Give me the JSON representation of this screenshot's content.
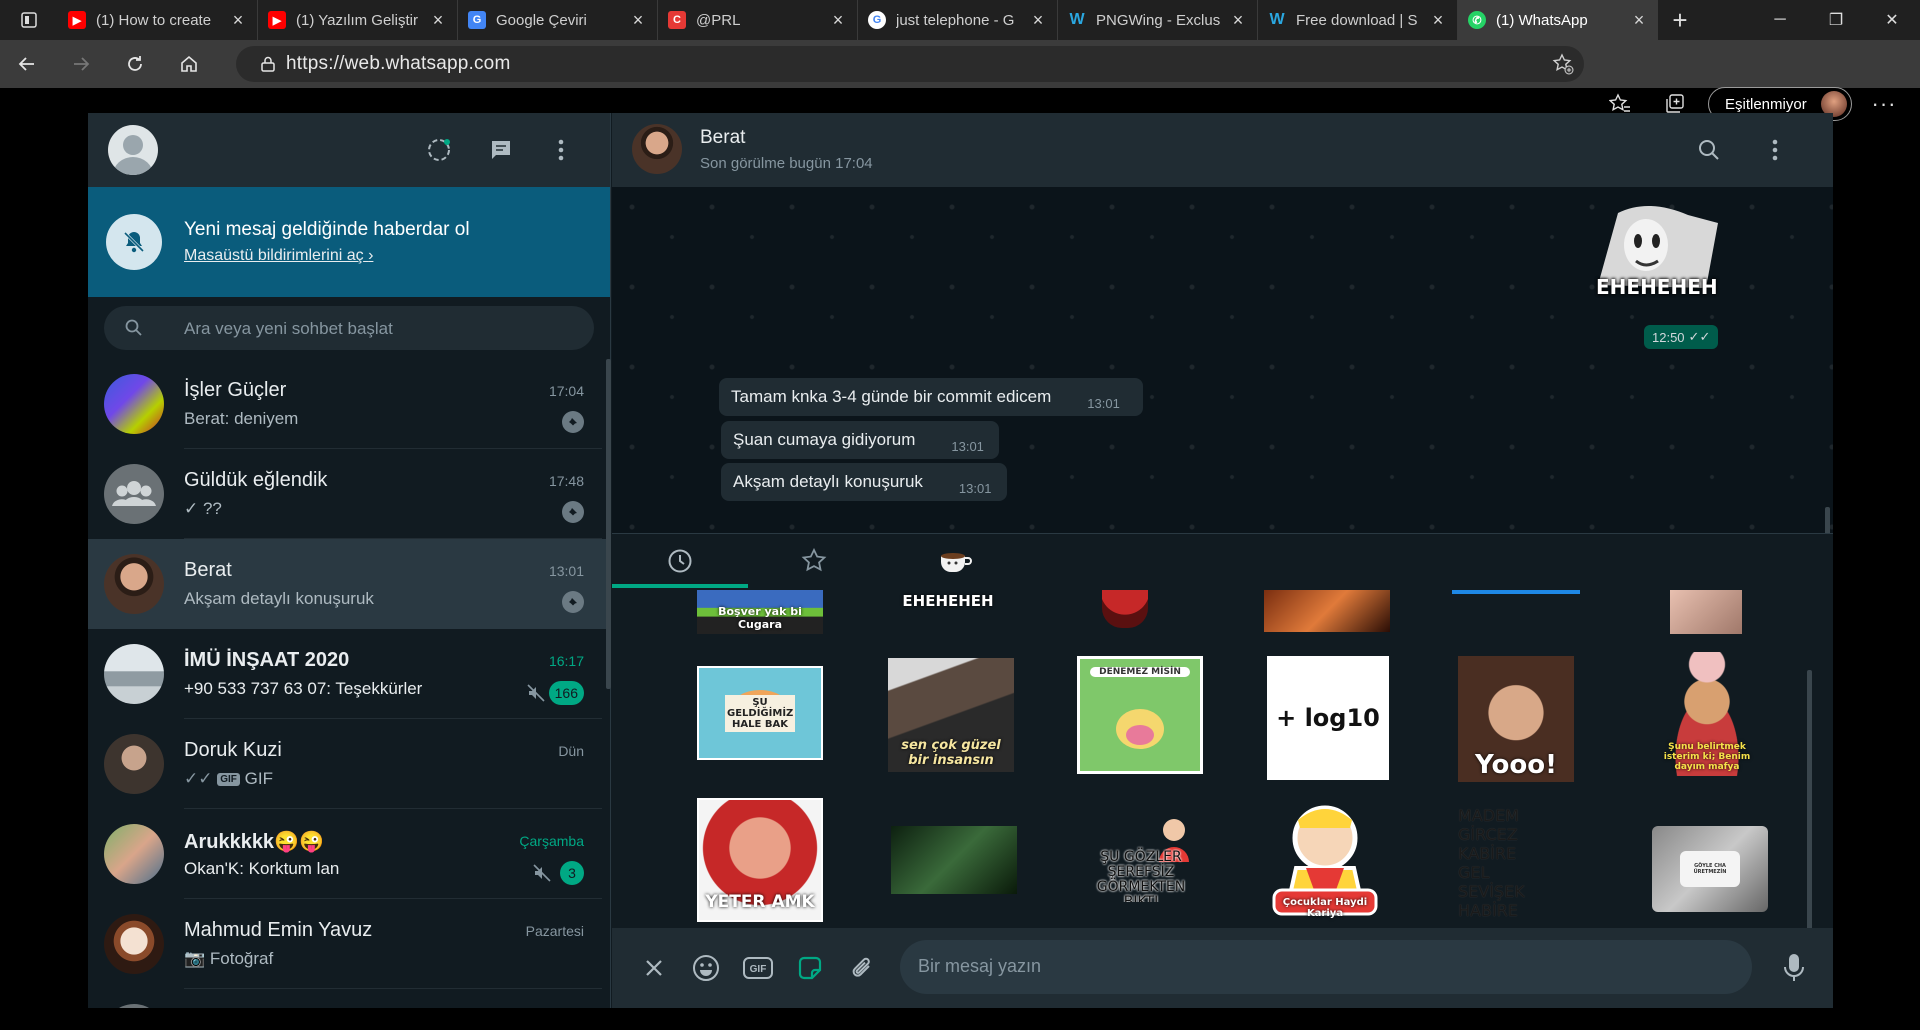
{
  "browser": {
    "tabs": [
      {
        "title": "(1) How to create",
        "icon": "youtube-icon"
      },
      {
        "title": "(1) Yazılım Geliştir",
        "icon": "youtube-icon"
      },
      {
        "title": "Google Çeviri",
        "icon": "google-translate-icon"
      },
      {
        "title": "@PRL",
        "icon": "chrome-web-icon"
      },
      {
        "title": "just telephone - G",
        "icon": "google-icon"
      },
      {
        "title": "PNGWing - Exclus",
        "icon": "pngwing-icon"
      },
      {
        "title": "Free download | S",
        "icon": "pngwing-icon"
      },
      {
        "title": "(1) WhatsApp",
        "icon": "whatsapp-icon"
      }
    ],
    "url": "https://web.whatsapp.com",
    "profile_label": "Eşitlenmiyor"
  },
  "sidebar": {
    "notification": {
      "title": "Yeni mesaj geldiğinde haberdar ol",
      "link": "Masaüstü bildirimlerini aç"
    },
    "search_placeholder": "Ara veya yeni sohbet başlat",
    "chats": [
      {
        "name": "İşler Güçler",
        "preview": "Berat: deniyem",
        "time": "17:04",
        "pinned": true
      },
      {
        "name": "Güldük eğlendik",
        "preview": "✓ ??",
        "time": "17:48",
        "pinned": true
      },
      {
        "name": "Berat",
        "preview": "Akşam detaylı konuşuruk",
        "time": "13:01",
        "pinned": true
      },
      {
        "name": "İMÜ İNŞAAT 2020",
        "preview": "+90 533 737 63 07: Teşekkürler",
        "time": "16:17",
        "unread": "166",
        "muted": true
      },
      {
        "name": "Doruk Kuzi",
        "preview_badge": "GIF",
        "preview": "GIF",
        "time": "Dün"
      },
      {
        "name": "Arukkkkk😜😜",
        "preview": "Okan'K: Korktum lan",
        "time": "Çarşamba",
        "unread": "3",
        "muted": true
      },
      {
        "name": "Mahmud Emin Yavuz",
        "preview": "Fotoğraf",
        "time": "Pazartesi"
      }
    ]
  },
  "conversation": {
    "contact_name": "Berat",
    "contact_status": "Son görülme bugün 17:04",
    "outgoing_sticker_caption": "EHEHEHEH",
    "outgoing_time": "12:50",
    "messages": [
      {
        "text": "Tamam knka 3-4 günde bir commit edicem",
        "time": "13:01"
      },
      {
        "text": "Şuan cumaya gidiyorum",
        "time": "13:01"
      },
      {
        "text": "Akşam detaylı konuşuruk",
        "time": "13:01"
      }
    ]
  },
  "sticker_panel": {
    "row1_captions": [
      "Boşver yak bi Cugara",
      "EHEHEHEH"
    ],
    "row2_captions": [
      "ŞU GELDİĞİMİZ HALE BAK",
      "sen çok güzel bir insansın",
      "DENEMEZ MİSİN",
      "+ log10",
      "Yooo!",
      "Şunu belirtmek isterim ki; Benim dayım mafya"
    ],
    "row3_captions": [
      "YETER AMK",
      "",
      "ŞU GÖZLER ŞEREFSİZ GÖRMEKTEN BIKTI",
      "Çocuklar Haydi Kariya",
      "MADEM GİRCEZ KABİRE GEL SEVİŞEK HABİRE",
      "GÖYLE CHA ÜRETMEZİN"
    ]
  },
  "composer": {
    "placeholder": "Bir mesaj yazın"
  }
}
